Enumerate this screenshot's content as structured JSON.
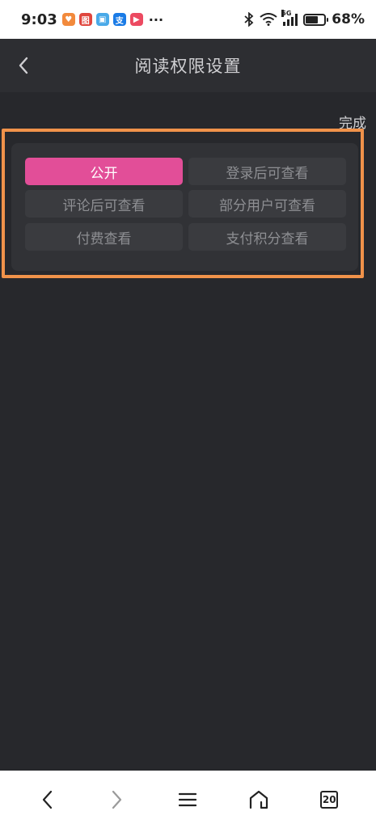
{
  "status_bar": {
    "time": "9:03",
    "apps": [
      {
        "name": "heart-app-icon",
        "color": "#f28a3c",
        "glyph": "♥"
      },
      {
        "name": "red-app-icon",
        "color": "#e0463e",
        "glyph": "图"
      },
      {
        "name": "book-app-icon",
        "color": "#49a9e8",
        "glyph": "▣"
      },
      {
        "name": "alipay-app-icon",
        "color": "#1a7be6",
        "glyph": "支"
      },
      {
        "name": "video-app-icon",
        "color": "#ec4a61",
        "glyph": "▶"
      }
    ],
    "more": "···",
    "network": "5G",
    "battery_percent": "68%",
    "battery_level": 0.68
  },
  "header": {
    "title": "阅读权限设置"
  },
  "done_label": "完成",
  "options": [
    {
      "label": "公开",
      "active": true
    },
    {
      "label": "登录后可查看",
      "active": false
    },
    {
      "label": "评论后可查看",
      "active": false
    },
    {
      "label": "部分用户可查看",
      "active": false
    },
    {
      "label": "付费查看",
      "active": false
    },
    {
      "label": "支付积分查看",
      "active": false
    }
  ],
  "bottom_nav": {
    "tab_count": "20"
  },
  "colors": {
    "accent": "#e24e98",
    "highlight": "#f0924a",
    "background": "#27282c"
  }
}
